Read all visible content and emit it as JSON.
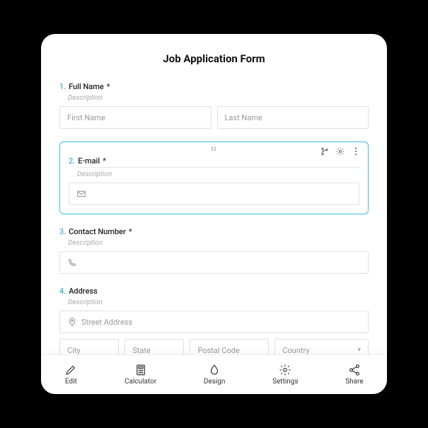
{
  "form": {
    "title": "Job Application Form",
    "description_label": "Description",
    "fields": {
      "full_name": {
        "num": "1.",
        "label": "Full Name",
        "required": "*",
        "first_ph": "First Name",
        "last_ph": "Last Name"
      },
      "email": {
        "num": "2.",
        "label": "E-mail",
        "required": "*"
      },
      "contact": {
        "num": "3.",
        "label": "Contact Number",
        "required": "*"
      },
      "address": {
        "num": "4.",
        "label": "Address",
        "street_ph": "Street Address",
        "city_ph": "City",
        "state_ph": "State",
        "postal_ph": "Postal Code",
        "country_ph": "Country"
      }
    }
  },
  "nav": {
    "edit": "Edit",
    "calculator": "Calculator",
    "design": "Design",
    "settings": "Settings",
    "share": "Share"
  }
}
